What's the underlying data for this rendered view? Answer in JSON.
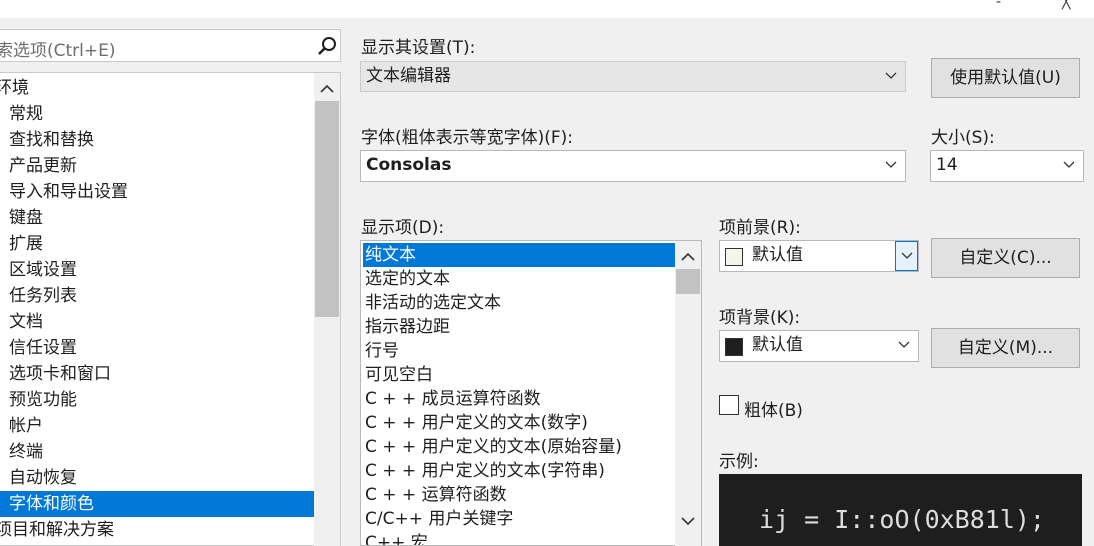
{
  "window": {
    "controls": [
      "-",
      "╳"
    ]
  },
  "search": {
    "placeholder": "索选项(Ctrl+E)"
  },
  "tree": {
    "items": [
      "环境",
      "常规",
      "查找和替换",
      "产品更新",
      "导入和导出设置",
      "键盘",
      "扩展",
      "区域设置",
      "任务列表",
      "文档",
      "信任设置",
      "选项卡和窗口",
      "预览功能",
      "帐户",
      "终端",
      "自动恢复",
      "字体和颜色",
      "项目和解决方案"
    ],
    "selected": "字体和颜色"
  },
  "settings": {
    "show_settings_for_label": "显示其设置(T):",
    "show_settings_for_value": "文本编辑器",
    "use_defaults_button": "使用默认值(U)",
    "font_label": "字体(粗体表示等宽字体)(F):",
    "font_value": "Consolas",
    "size_label": "大小(S):",
    "size_value": "14",
    "display_items_label": "显示项(D):",
    "display_items": [
      "纯文本",
      "选定的文本",
      "非活动的选定文本",
      "指示器边距",
      "行号",
      "可见空白",
      "C + + 成员运算符函数",
      "C + + 用户定义的文本(数字)",
      "C + + 用户定义的文本(原始容量)",
      "C + + 用户定义的文本(字符串)",
      "C + + 运算符函数",
      "C/C++ 用户关键字",
      "C++ 宏"
    ],
    "selected_display_item": "纯文本",
    "foreground_label": "项前景(R):",
    "foreground_value": "默认值",
    "foreground_color": "#f5f5f0",
    "custom_fg_button": "自定义(C)...",
    "background_label": "项背景(K):",
    "background_value": "默认值",
    "background_color": "#1e1e1e",
    "custom_bg_button": "自定义(M)...",
    "bold_label": "粗体(B)",
    "bold_checked": false,
    "sample_label": "示例:",
    "sample_text": "ij = I::oO(0xB81l);"
  }
}
